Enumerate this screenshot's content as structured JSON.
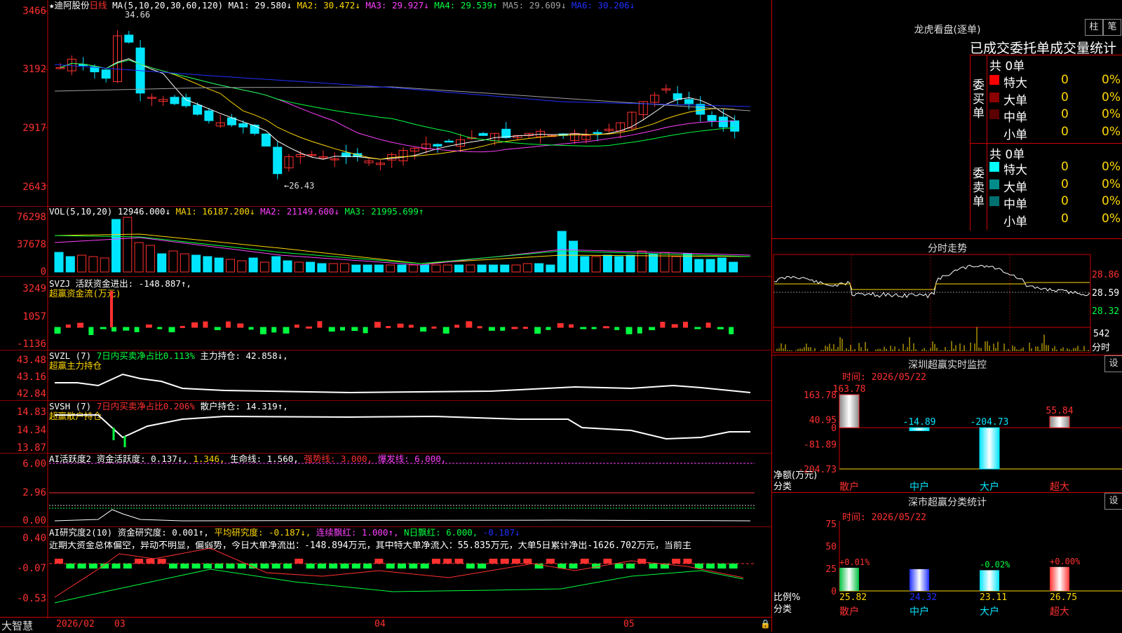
{
  "colors": {
    "up": "#ff3030",
    "down": "#00e5ff",
    "ma1": "#ffffff",
    "ma2": "#ffd700",
    "ma3": "#ff40ff",
    "ma4": "#00ff40",
    "ma5": "#a0a0a0",
    "ma6": "#2030ff"
  },
  "kline": {
    "title_star": "★",
    "stock": "迪阿股份",
    "period": "日线",
    "ma_spec": "MA(5,10,20,30,60,120)",
    "ma_values": [
      {
        "label": "MA1: 29.580↓",
        "color": "ma1"
      },
      {
        "label": "MA2: 30.472↓",
        "color": "ma2"
      },
      {
        "label": "MA3: 29.927↓",
        "color": "ma3"
      },
      {
        "label": "MA4: 29.539↑",
        "color": "ma4"
      },
      {
        "label": "MA5: 29.609↓",
        "color": "ma5"
      },
      {
        "label": "MA6: 30.206↓",
        "color": "ma6"
      }
    ],
    "y_ticks": [
      "3466",
      "3192",
      "2917",
      "2643"
    ],
    "high_label": "34.66",
    "low_label": "←26.43"
  },
  "vol": {
    "label": "VOL(5,10,20)",
    "value": "12946.000↓",
    "ma1": "MA1: 16187.200↓",
    "ma2": "MA2: 21149.600↓",
    "ma3": "MA3: 21995.699↑",
    "y_ticks": [
      "76298",
      "37678",
      "0"
    ]
  },
  "svzj": {
    "label": "SVZJ",
    "text": "活跃资金进出: -148.887↑,",
    "sub": "超赢资金流(万元)",
    "y_ticks": [
      "3249",
      "1057",
      "-1136"
    ]
  },
  "svzl": {
    "label": "SVZL (7)",
    "text1": "7日内买卖净占比0.113%",
    "text2": "主力持仓: 42.858↓,",
    "sub": "超赢主力持仓",
    "y_ticks": [
      "43.48",
      "43.16",
      "42.84"
    ]
  },
  "svsh": {
    "label": "SVSH (7)",
    "text1": "7日内买卖净占比0.206%",
    "text2": "散户持仓: 14.319↑,",
    "sub": "超赢散户持仓",
    "y_ticks": [
      "14.83",
      "14.34",
      "13.87"
    ]
  },
  "ai1": {
    "label": "AI活跃度2",
    "text1": "资金活跃度: 0.137↓,",
    "text2": "1.346,",
    "text3": "生命线: 1.560,",
    "text4": "强势线: 3.000,",
    "text5": "爆发线: 6.000,",
    "y_ticks": [
      "6.00",
      "2.96",
      "0.00"
    ]
  },
  "ai2": {
    "label": "AI研究度2(10)",
    "text1": "资金研究度: 0.001↑,",
    "text2": "平均研究度: -0.187↓,",
    "text3": "连续飘红: 1.000↑,",
    "text4": "N日飘红: 6.000,",
    "text5": "-0.187↓",
    "summary": "近期大资金总体偏空，异动不明显，偏弱势，今日大单净流出：-148.894万元，其中特大单净流入：55.835万元，大单5日累计净出-1626.702万元，当前主",
    "y_ticks": [
      "0.40",
      "-0.07",
      "-0.53"
    ]
  },
  "footer": {
    "brand": "大智慧",
    "months": [
      "2026/02",
      "03",
      "04",
      "05"
    ]
  },
  "lhb": {
    "title": "龙虎看盘(逐单)",
    "btn1": "柱",
    "btn2": "笔",
    "tabs": "已成交委托单成交量统计",
    "buy_side": "委买单",
    "sell_side": "委卖单",
    "buy_total": "共 0单",
    "sell_total": "共 0单",
    "rows": [
      {
        "name": "特大",
        "count": "0",
        "pct": "0%",
        "buy_color": "#ff0000",
        "sell_color": "#00ffff"
      },
      {
        "name": "大单",
        "count": "0",
        "pct": "0%",
        "buy_color": "#8b0000",
        "sell_color": "#008b8b"
      },
      {
        "name": "中单",
        "count": "0",
        "pct": "0%",
        "buy_color": "#5a0000",
        "sell_color": "#007070"
      },
      {
        "name": "小单",
        "count": "0",
        "pct": "0%",
        "buy_color": "",
        "sell_color": ""
      }
    ]
  },
  "fenshi": {
    "title": "分时走势",
    "y_ticks": [
      "28.86",
      "28.59",
      "28.32"
    ],
    "vol_tick": "542",
    "vol_label": "分时"
  },
  "monitor": {
    "title": "深圳超赢实时监控",
    "btn": "设",
    "time": "时间: 2026/05/22",
    "y_ticks": [
      "163.78",
      "40.95",
      "0",
      "-81.89",
      "-204.73"
    ],
    "ylabel1": "净额(万元)",
    "ylabel2": "分类",
    "categories": [
      "散户",
      "中户",
      "大户",
      "超大"
    ],
    "values": [
      163.78,
      -14.89,
      -204.73,
      55.84
    ],
    "value_labels": [
      "163.78",
      "-14.89",
      "-204.73",
      "55.84"
    ]
  },
  "classify": {
    "title": "深市超赢分类统计",
    "btn": "设",
    "time": "时间: 2026/05/22",
    "y_ticks": [
      "75",
      "50",
      "25",
      "0"
    ],
    "ylabel1": "比例%",
    "ylabel2": "分类",
    "categories": [
      "散户",
      "中户",
      "大户",
      "超大"
    ],
    "values": [
      25.82,
      24.32,
      23.11,
      26.75
    ],
    "top_labels": [
      "+0.01%",
      "",
      "-0.02%",
      "+0.00%"
    ],
    "value_labels": [
      "25.82",
      "24.32",
      "23.11",
      "26.75"
    ]
  },
  "chart_data": {
    "type": "bar",
    "title": "深圳超赢实时监控",
    "categories": [
      "散户",
      "中户",
      "大户",
      "超大"
    ],
    "series": [
      {
        "name": "净额(万元)",
        "values": [
          163.78,
          -14.89,
          -204.73,
          55.84
        ]
      },
      {
        "name": "比例%",
        "values": [
          25.82,
          24.32,
          23.11,
          26.75
        ]
      }
    ],
    "ylim": [
      -204.73,
      163.78
    ]
  }
}
